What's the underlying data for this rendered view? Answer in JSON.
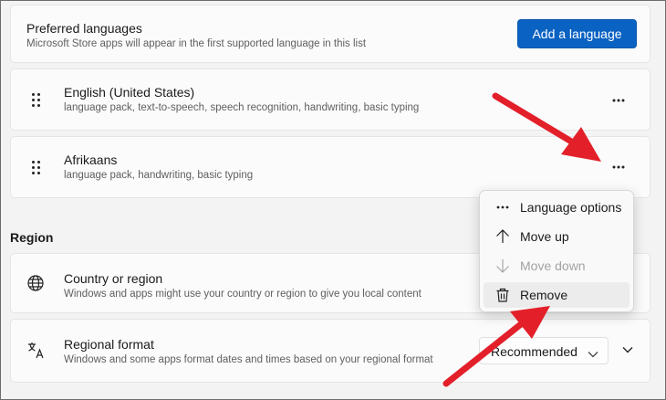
{
  "preferred_languages": {
    "title": "Preferred languages",
    "subtitle": "Microsoft Store apps will appear in the first supported language in this list",
    "add_button": "Add a language"
  },
  "languages": [
    {
      "name": "English (United States)",
      "features": "language pack, text-to-speech, speech recognition, handwriting, basic typing"
    },
    {
      "name": "Afrikaans",
      "features": "language pack, handwriting, basic typing"
    }
  ],
  "region": {
    "heading": "Region",
    "country": {
      "title": "Country or region",
      "subtitle": "Windows and apps might use your country or region to give you local content"
    },
    "format": {
      "title": "Regional format",
      "subtitle": "Windows and some apps format dates and times based on your regional format",
      "selected": "Recommended"
    }
  },
  "context_menu": {
    "items": [
      {
        "label": "Language options",
        "icon": "more-icon",
        "enabled": true
      },
      {
        "label": "Move up",
        "icon": "arrow-up-icon",
        "enabled": true
      },
      {
        "label": "Move down",
        "icon": "arrow-down-icon",
        "enabled": false
      },
      {
        "label": "Remove",
        "icon": "trash-icon",
        "enabled": true,
        "highlighted": true
      }
    ]
  },
  "colors": {
    "accent": "#0a62c2",
    "annotation_arrow": "#e3202a"
  }
}
